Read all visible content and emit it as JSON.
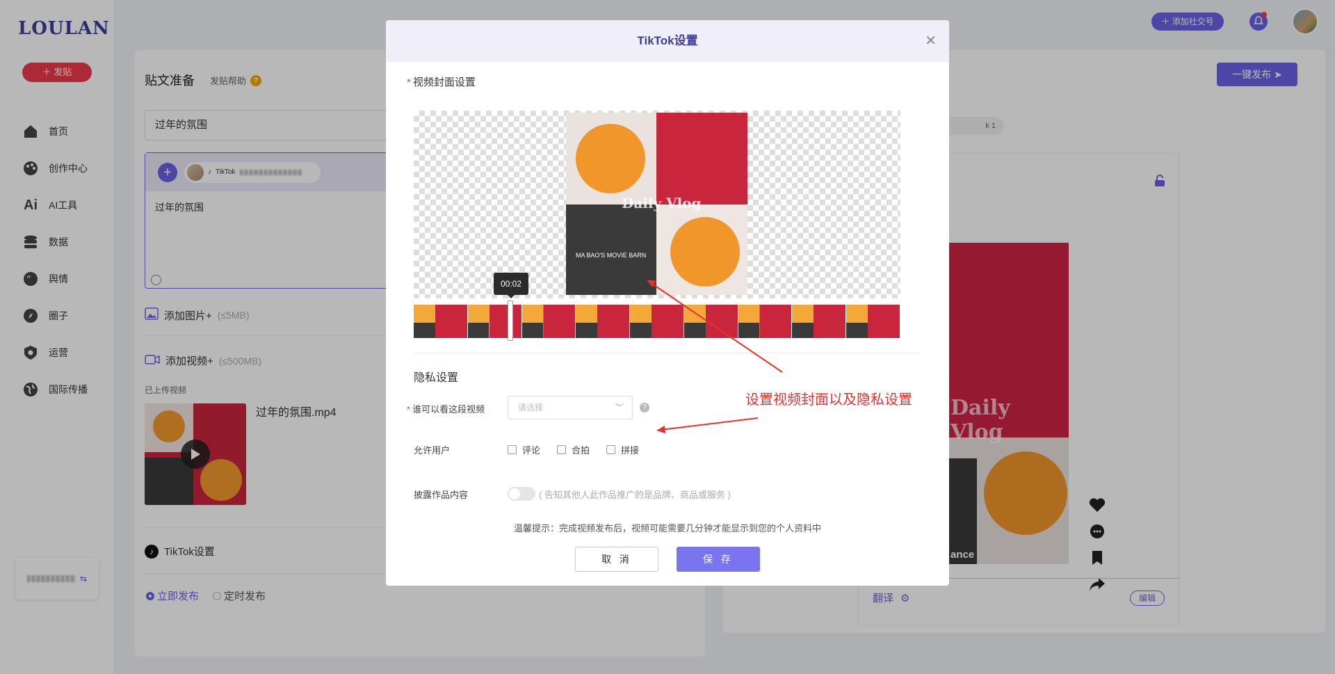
{
  "app": {
    "logo": "LOULAN",
    "post_button": "发贴"
  },
  "sidebar": {
    "items": [
      {
        "label": "首页",
        "icon": "home-icon"
      },
      {
        "label": "创作中心",
        "icon": "palette-icon"
      },
      {
        "label": "AI工具",
        "icon": "ai-icon"
      },
      {
        "label": "数据",
        "icon": "database-icon"
      },
      {
        "label": "舆情",
        "icon": "quote-icon"
      },
      {
        "label": "圈子",
        "icon": "compass-icon"
      },
      {
        "label": "运营",
        "icon": "badge-icon"
      },
      {
        "label": "国际传播",
        "icon": "globe-icon"
      }
    ],
    "account_switch_icon": "switch-icon"
  },
  "topbar": {
    "add_social_account": "添加社交号"
  },
  "editor": {
    "title": "贴文准备",
    "help": "发贴帮助",
    "title_value": "过年的氛围",
    "account_chip_platform": "TikTok",
    "body_text": "过年的氛围",
    "add_image": "添加图片+",
    "add_image_limit": "(≤5MB)",
    "add_video": "添加视频+",
    "add_video_limit": "(≤500MB)",
    "uploaded_label": "已上传视频",
    "video_filename": "过年的氛围.mp4",
    "tiktok_settings": "TikTok设置",
    "publish_now": "立即发布",
    "publish_scheduled": "定时发布"
  },
  "preview": {
    "one_click_publish": "一键发布",
    "account_count_suffix": "k  1",
    "video_watermark": "Daily Vlog",
    "video_caption": "ance",
    "translate": "翻译",
    "edit": "编辑"
  },
  "modal": {
    "title": "TikTok设置",
    "cover_section": "视频封面设置",
    "cover_overlay_text": "Daily Vlog",
    "clapper_text": "MA BAO'S MOVIE BARN",
    "timeline_time": "00:02",
    "privacy_section": "隐私设置",
    "who_can_view_label": "谁可以看这段视频",
    "who_can_view_placeholder": "请选择",
    "allow_users_label": "允许用户",
    "allow_options": [
      "评论",
      "合拍",
      "拼接"
    ],
    "disclose_label": "披露作品内容",
    "disclose_note": "( 告知其他人此作品推广的是品牌、商品或服务 )",
    "hint": "温馨提示：完成视频发布后，视频可能需要几分钟才能显示到您的个人资料中",
    "cancel": "取 消",
    "save": "保 存"
  },
  "annotation": {
    "text": "设置视频封面以及隐私设置",
    "color": "#e8312d"
  },
  "colors": {
    "accent": "#6b62e6",
    "brand_red": "#f0394d",
    "video_red": "#c9253c"
  }
}
